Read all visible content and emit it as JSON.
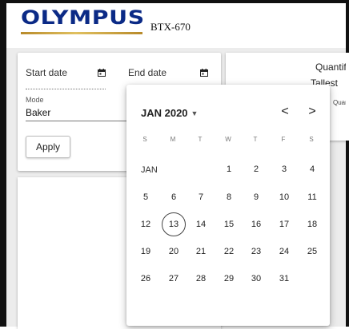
{
  "header": {
    "logo_text": "OLYMPUS",
    "model": "BTX-670"
  },
  "filter": {
    "start_label": "Start date",
    "end_label": "End date",
    "mode_label": "Mode",
    "mode_value": "Baker",
    "apply_label": "Apply",
    "calendar_icon": "calendar-icon"
  },
  "right_panel": {
    "title": "Quantific",
    "subtitle": "Tallest",
    "column": "Quar"
  },
  "calendar": {
    "month_year": "JAN 2020",
    "month_label": "JAN",
    "weekdays": [
      "S",
      "M",
      "T",
      "W",
      "T",
      "F",
      "S"
    ],
    "today": 13,
    "weeks": [
      [
        "",
        "",
        "",
        "1",
        "2",
        "3",
        "4"
      ],
      [
        "5",
        "6",
        "7",
        "8",
        "9",
        "10",
        "11"
      ],
      [
        "12",
        "13",
        "14",
        "15",
        "16",
        "17",
        "18"
      ],
      [
        "19",
        "20",
        "21",
        "22",
        "23",
        "24",
        "25"
      ],
      [
        "26",
        "27",
        "28",
        "29",
        "30",
        "31",
        ""
      ]
    ],
    "prev_label": "<",
    "next_label": ">"
  },
  "colors": {
    "brand": "#0b2a86",
    "accent_line": "#c9a13a"
  }
}
